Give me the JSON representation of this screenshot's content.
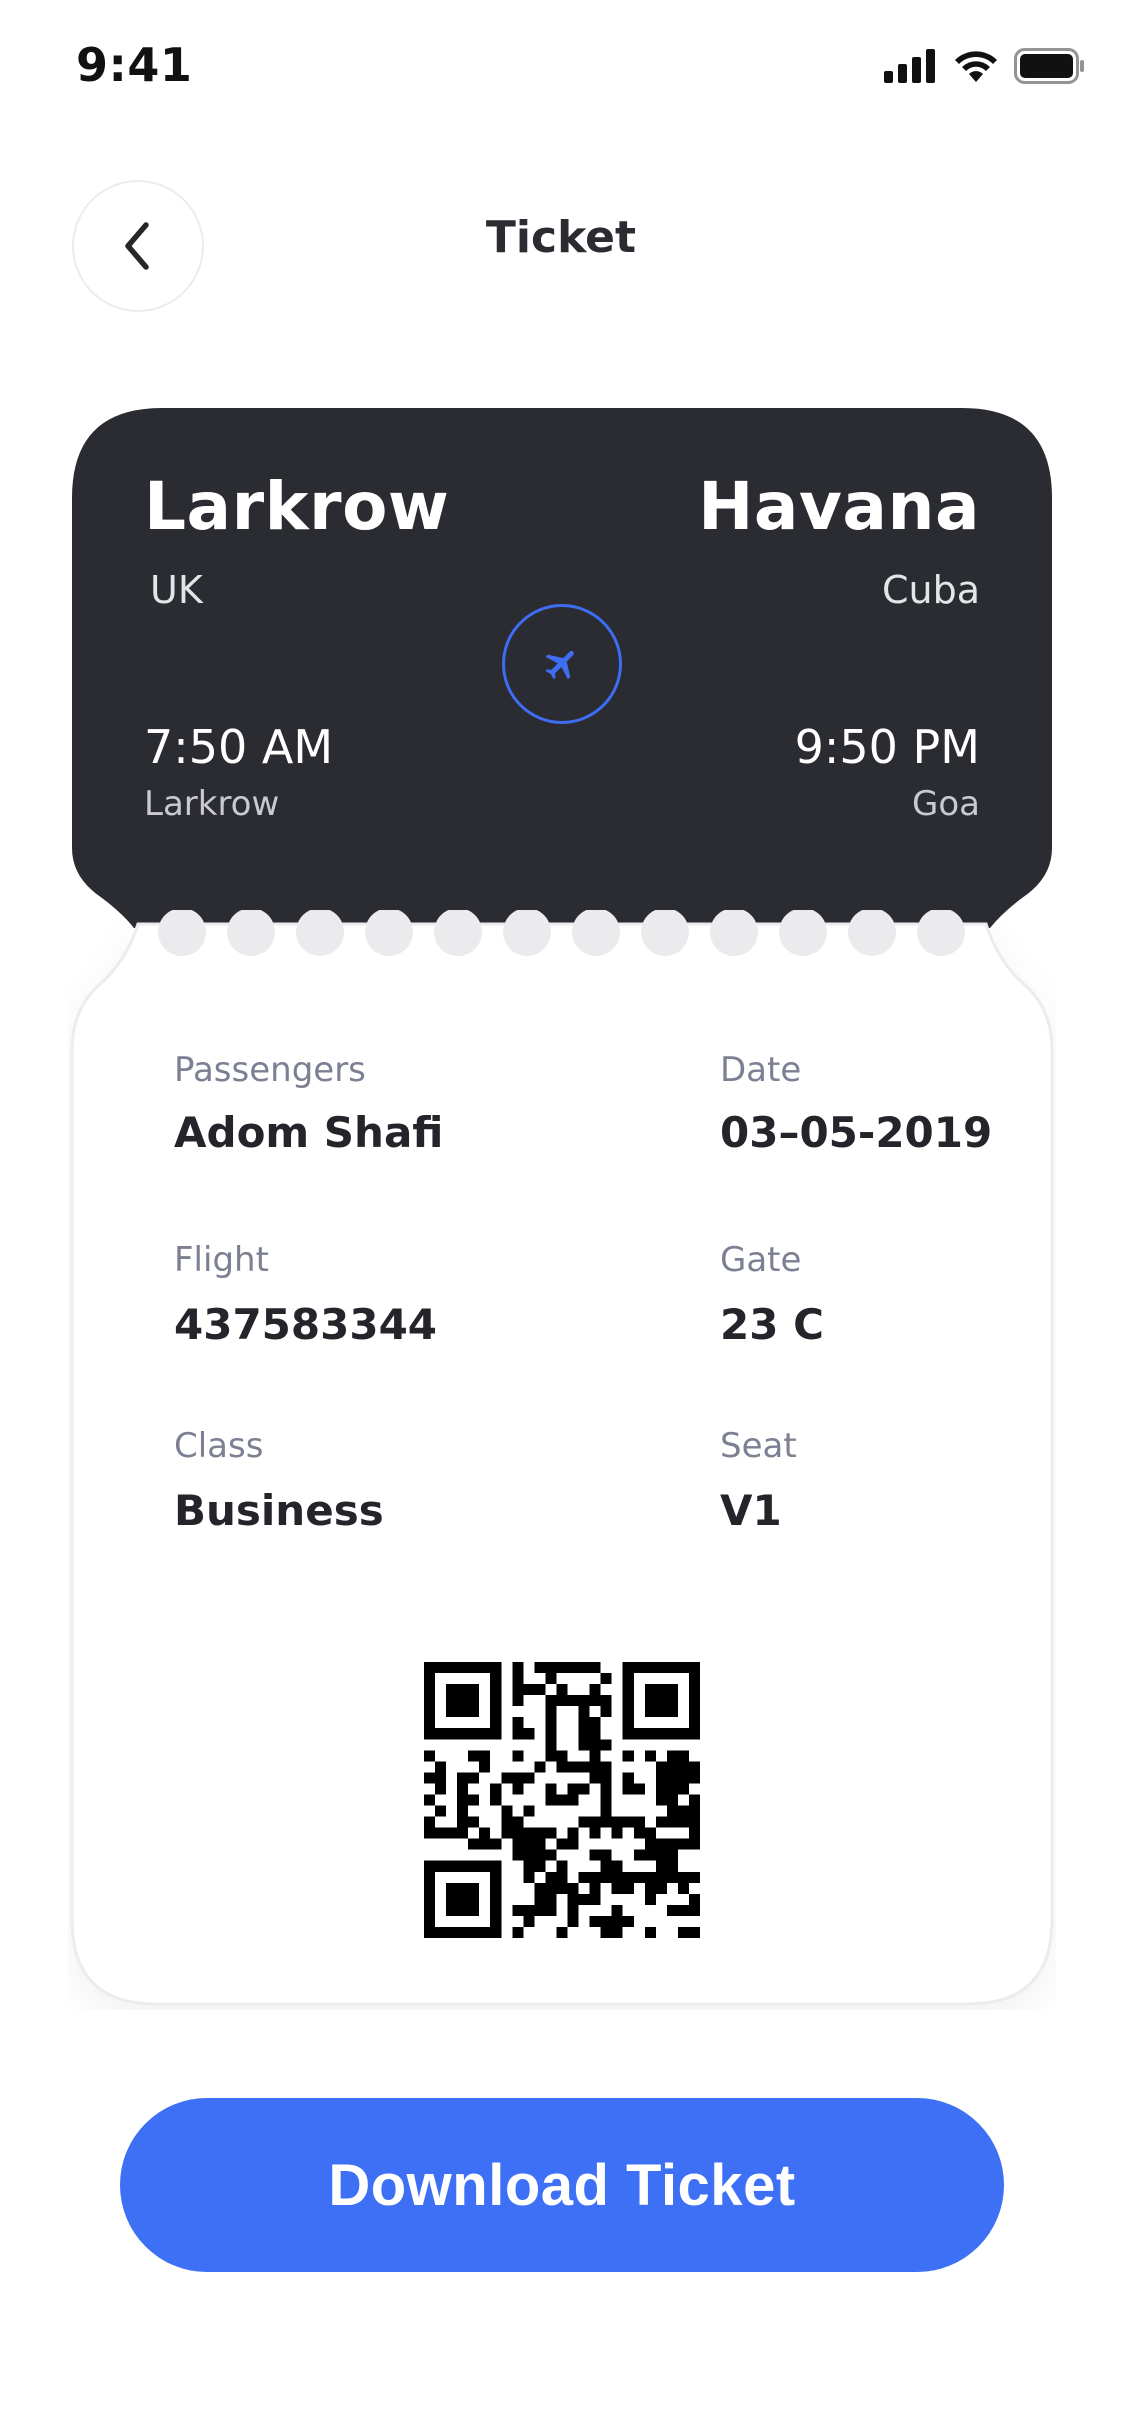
{
  "status_bar": {
    "time": "9:41",
    "icons": [
      "signal-icon",
      "wifi-icon",
      "battery-icon"
    ]
  },
  "header": {
    "title": "Ticket",
    "back_icon": "chevron-left-icon"
  },
  "ticket": {
    "from": {
      "city": "Larkrow",
      "country": "UK",
      "time": "7:50 AM",
      "place": "Larkrow"
    },
    "to": {
      "city": "Havana",
      "country": "Cuba",
      "time": "9:50 PM",
      "place": "Goa"
    },
    "plane_icon": "airplane-icon",
    "details": {
      "passengers": {
        "label": "Passengers",
        "value": "Adom Shafi"
      },
      "date": {
        "label": "Date",
        "value": "03–05-2019"
      },
      "flight": {
        "label": "Flight",
        "value": "437583344"
      },
      "gate": {
        "label": "Gate",
        "value": "23 C"
      },
      "class": {
        "label": "Class",
        "value": "Business"
      },
      "seat": {
        "label": "Seat",
        "value": "V1"
      }
    },
    "qr_icon": "qr-code-icon"
  },
  "download_button": {
    "label": "Download Ticket"
  },
  "colors": {
    "accent": "#3d70f5",
    "ticket_dark": "#2a2c31",
    "text_dark": "#24252a",
    "label_gray": "#7c8092"
  }
}
